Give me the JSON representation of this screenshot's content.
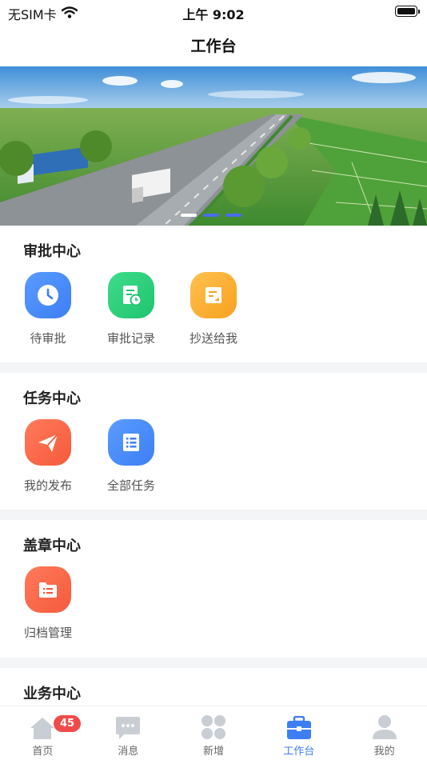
{
  "status_bar": {
    "carrier": "无SIM卡",
    "time": "上午 9:02"
  },
  "nav": {
    "title": "工作台"
  },
  "sections": [
    {
      "title": "审批中心",
      "items": [
        {
          "label": "待审批",
          "icon": "clock-icon",
          "color": "#4287f5"
        },
        {
          "label": "审批记录",
          "icon": "document-clock-icon",
          "color": "#27c775"
        },
        {
          "label": "抄送给我",
          "icon": "cc-send-icon",
          "color": "#f8a825"
        }
      ]
    },
    {
      "title": "任务中心",
      "items": [
        {
          "label": "我的发布",
          "icon": "paper-plane-icon",
          "color": "#f5613f"
        },
        {
          "label": "全部任务",
          "icon": "list-icon",
          "color": "#4287f5"
        }
      ]
    },
    {
      "title": "盖章中心",
      "items": [
        {
          "label": "归档管理",
          "icon": "folder-icon",
          "color": "#f5613f"
        }
      ]
    },
    {
      "title": "业务中心",
      "items": []
    }
  ],
  "tab_bar": {
    "items": [
      {
        "label": "首页",
        "icon": "home-icon",
        "badge": "45"
      },
      {
        "label": "消息",
        "icon": "message-icon"
      },
      {
        "label": "新增",
        "icon": "grid-add-icon"
      },
      {
        "label": "工作台",
        "icon": "briefcase-icon",
        "active": true
      },
      {
        "label": "我的",
        "icon": "user-icon"
      }
    ],
    "active_color": "#3d7ef5"
  }
}
